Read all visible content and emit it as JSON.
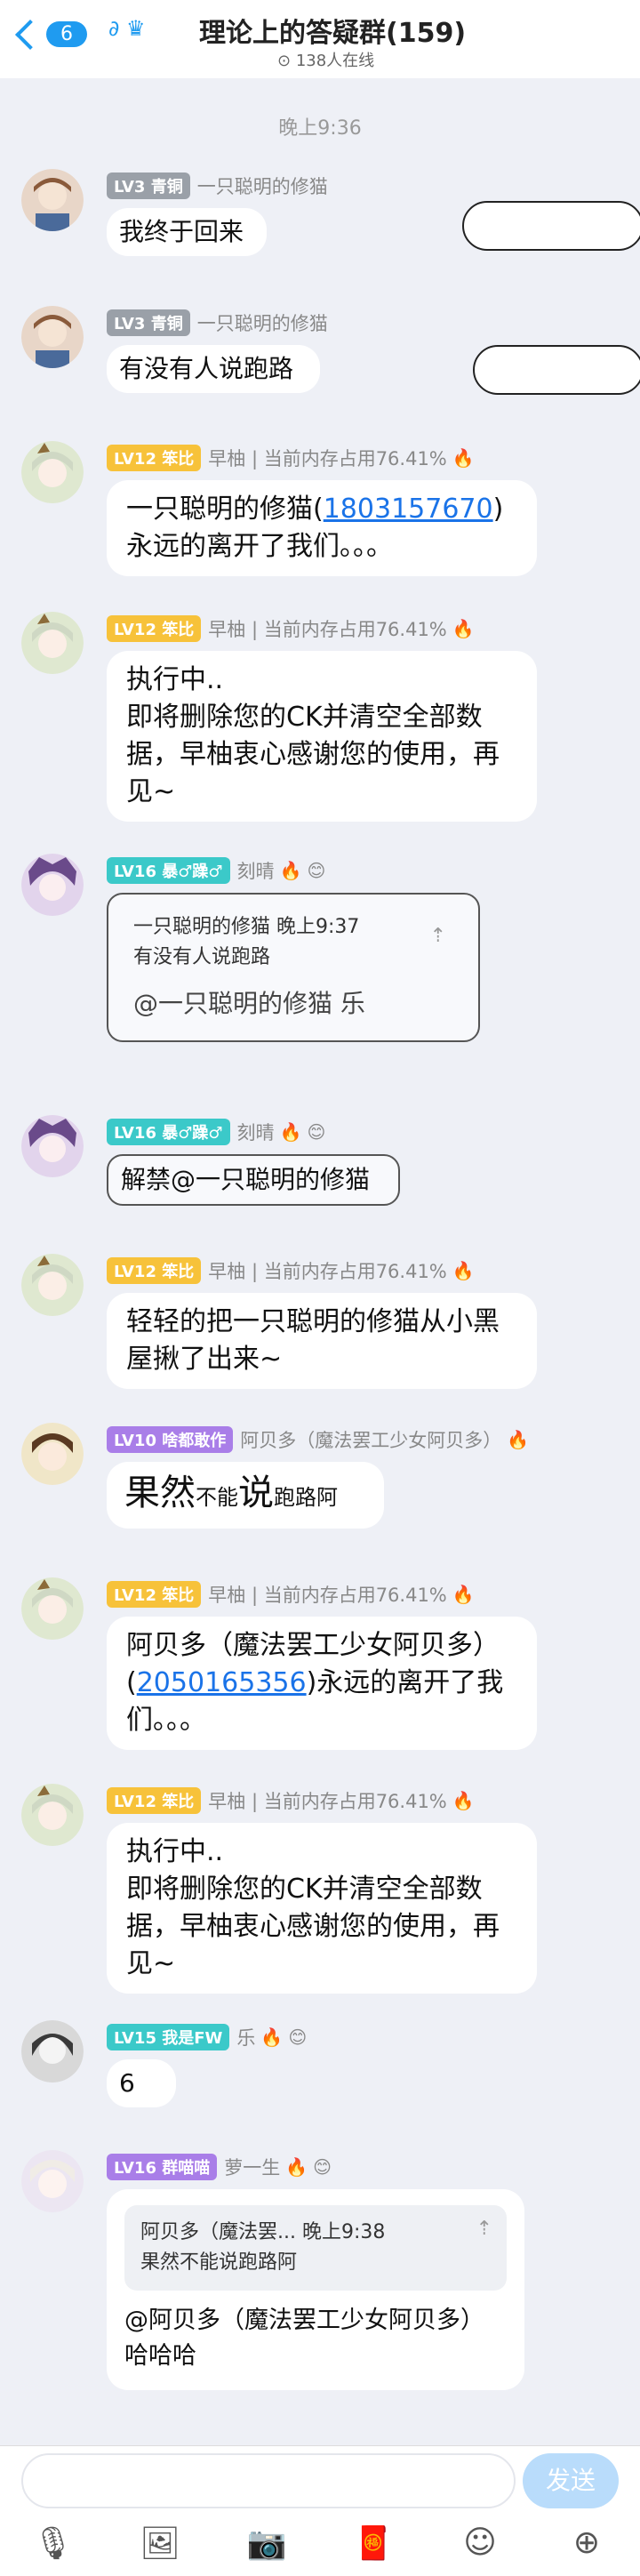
{
  "header": {
    "back_count": "6",
    "title": "理论上的答疑群(159)",
    "online": "138人在线"
  },
  "time_label": "晚上9:36",
  "messages": [
    {
      "level": "LV3",
      "title": "青铜",
      "name": "一只聪明的修猫",
      "text": "我终于回来"
    },
    {
      "level": "LV3",
      "title": "青铜",
      "name": "一只聪明的修猫",
      "text": "有没有人说跑路"
    },
    {
      "level": "LV12",
      "title": "笨比",
      "name": "早柚 | 当前内存占用76.41%",
      "text_before": "一只聪明的修猫(",
      "link": "1803157670",
      "text_after": ")永远的离开了我们。。。"
    },
    {
      "level": "LV12",
      "title": "笨比",
      "name": "早柚 | 当前内存占用76.41%",
      "text": "执行中..\n即将删除您的CK并清空全部数据，早柚衷心感谢您的使用，再见~"
    },
    {
      "level": "LV16",
      "title": "暴♂躁♂",
      "name": "刻晴",
      "quote_name": "一只聪明的修猫",
      "quote_time": "晚上9:37",
      "quote_text": "有没有人说跑路",
      "text": "@一只聪明的修猫 乐"
    },
    {
      "level": "LV16",
      "title": "暴♂躁♂",
      "name": "刻晴",
      "text": "解禁@一只聪明的修猫"
    },
    {
      "level": "LV12",
      "title": "笨比",
      "name": "早柚 | 当前内存占用76.41%",
      "text": "轻轻的把一只聪明的修猫从小黑屋揪了出来~"
    },
    {
      "level": "LV10",
      "title": "啥都敢作",
      "name": "阿贝多（魔法罢工少女阿贝多）",
      "text_big1": "果然",
      "text_sm1": "不能",
      "text_big2": "说",
      "text_sm2": "跑路阿"
    },
    {
      "level": "LV12",
      "title": "笨比",
      "name": "早柚 | 当前内存占用76.41%",
      "text_before": "阿贝多（魔法罢工少女阿贝多）(",
      "link": "2050165356",
      "text_after": ")永远的离开了我们。。。"
    },
    {
      "level": "LV12",
      "title": "笨比",
      "name": "早柚 | 当前内存占用76.41%",
      "text": "执行中..\n即将删除您的CK并清空全部数据，早柚衷心感谢您的使用，再见~"
    },
    {
      "level": "LV15",
      "title": "我是FW",
      "name": "乐",
      "text": "6"
    },
    {
      "level": "LV16",
      "title": "群喵喵",
      "name": "萝一生",
      "quote_name": "阿贝多（魔法罢...",
      "quote_time": "晚上9:38",
      "quote_text": "果然不能说跑路阿",
      "text": "@阿贝多（魔法罢工少女阿贝多） 哈哈哈"
    }
  ],
  "colors": {
    "accent": "#1f9bf0",
    "lv_gold": "#f7c23a",
    "lv_teal": "#3bc9c9",
    "lv_purple": "#a97ee8",
    "lv_gray": "#9aa0a8",
    "send_disabled": "#b9dcfb"
  },
  "bottom": {
    "send_label": "发送"
  },
  "toolbar_icons": [
    "mic-icon",
    "image-icon",
    "camera-icon",
    "red-packet-icon",
    "emoji-icon",
    "plus-icon"
  ]
}
